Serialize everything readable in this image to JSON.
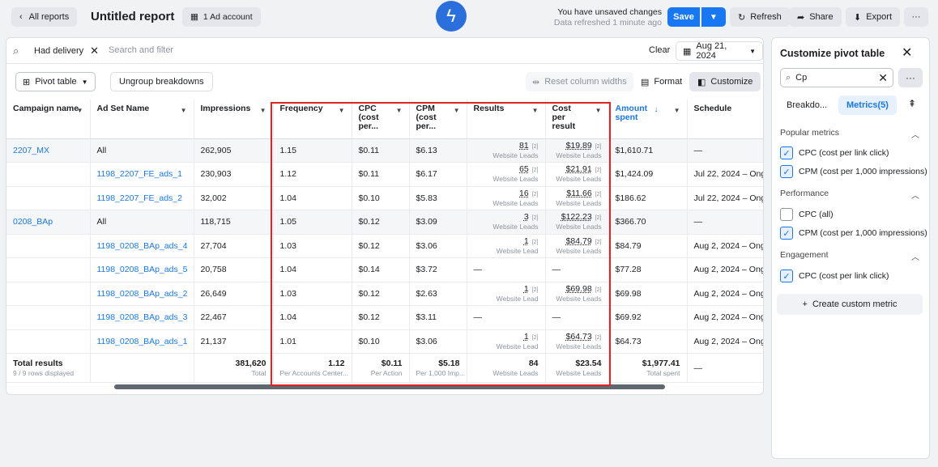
{
  "topbar": {
    "back_label": "All reports",
    "title": "Untitled report",
    "account_label": "1 Ad account",
    "unsaved_line1": "You have unsaved changes",
    "unsaved_line2": "Data refreshed 1 minute ago",
    "save_label": "Save",
    "refresh_label": "Refresh",
    "share_label": "Share",
    "export_label": "Export"
  },
  "filterbar": {
    "chip_label": "Had delivery",
    "search_placeholder": "Search and filter",
    "clear_label": "Clear",
    "date_label": "Aug 21, 2024"
  },
  "toolbar": {
    "pivot_label": "Pivot table",
    "ungroup_label": "Ungroup breakdowns",
    "reset_label": "Reset column widths",
    "format_label": "Format",
    "customize_label": "Customize"
  },
  "table": {
    "headers": [
      "Campaign name",
      "Ad Set Name",
      "Impressions",
      "Frequency",
      "CPC (cost per...",
      "CPM (cost per...",
      "Results",
      "Cost per result",
      "Amount spent",
      "Schedule"
    ],
    "rows": [
      {
        "campaign": "2207_MX",
        "adset": "All",
        "impressions": "262,905",
        "frequency": "1.15",
        "cpc": "$0.11",
        "cpm": "$6.13",
        "results": "81",
        "results_label": "Website Leads",
        "cpr": "$19.89",
        "cpr_label": "Website Leads",
        "spent": "$1,610.71",
        "schedule": "—",
        "group": true
      },
      {
        "campaign": "",
        "adset": "1198_2207_FE_ads_1",
        "impressions": "230,903",
        "frequency": "1.12",
        "cpc": "$0.11",
        "cpm": "$6.17",
        "results": "65",
        "results_label": "Website Leads",
        "cpr": "$21.91",
        "cpr_label": "Website Leads",
        "spent": "$1,424.09",
        "schedule": "Jul 22, 2024 – Ongoing",
        "group": false
      },
      {
        "campaign": "",
        "adset": "1198_2207_FE_ads_2",
        "impressions": "32,002",
        "frequency": "1.04",
        "cpc": "$0.10",
        "cpm": "$5.83",
        "results": "16",
        "results_label": "Website Leads",
        "cpr": "$11.66",
        "cpr_label": "Website Leads",
        "spent": "$186.62",
        "schedule": "Jul 22, 2024 – Ongoing",
        "group": false
      },
      {
        "campaign": "0208_BAp",
        "adset": "All",
        "impressions": "118,715",
        "frequency": "1.05",
        "cpc": "$0.12",
        "cpm": "$3.09",
        "results": "3",
        "results_label": "Website Leads",
        "cpr": "$122.23",
        "cpr_label": "Website Leads",
        "spent": "$366.70",
        "schedule": "—",
        "group": true
      },
      {
        "campaign": "",
        "adset": "1198_0208_BAp_ads_4",
        "impressions": "27,704",
        "frequency": "1.03",
        "cpc": "$0.12",
        "cpm": "$3.06",
        "results": "1",
        "results_label": "Website Lead",
        "cpr": "$84.79",
        "cpr_label": "Website Leads",
        "spent": "$84.79",
        "schedule": "Aug 2, 2024 – Ongoing",
        "group": false
      },
      {
        "campaign": "",
        "adset": "1198_0208_BAp_ads_5",
        "impressions": "20,758",
        "frequency": "1.04",
        "cpc": "$0.14",
        "cpm": "$3.72",
        "results": "—",
        "results_label": "",
        "cpr": "—",
        "cpr_label": "",
        "spent": "$77.28",
        "schedule": "Aug 2, 2024 – Ongoing",
        "group": false
      },
      {
        "campaign": "",
        "adset": "1198_0208_BAp_ads_2",
        "impressions": "26,649",
        "frequency": "1.03",
        "cpc": "$0.12",
        "cpm": "$2.63",
        "results": "1",
        "results_label": "Website Lead",
        "cpr": "$69.98",
        "cpr_label": "Website Leads",
        "spent": "$69.98",
        "schedule": "Aug 2, 2024 – Ongoing",
        "group": false
      },
      {
        "campaign": "",
        "adset": "1198_0208_BAp_ads_3",
        "impressions": "22,467",
        "frequency": "1.04",
        "cpc": "$0.12",
        "cpm": "$3.11",
        "results": "—",
        "results_label": "",
        "cpr": "—",
        "cpr_label": "",
        "spent": "$69.92",
        "schedule": "Aug 2, 2024 – Ongoing",
        "group": false
      },
      {
        "campaign": "",
        "adset": "1198_0208_BAp_ads_1",
        "impressions": "21,137",
        "frequency": "1.01",
        "cpc": "$0.10",
        "cpm": "$3.06",
        "results": "1",
        "results_label": "Website Lead",
        "cpr": "$64.73",
        "cpr_label": "Website Leads",
        "spent": "$64.73",
        "schedule": "Aug 2, 2024 – Ongoing",
        "group": false
      }
    ],
    "totals": {
      "label": "Total results",
      "sublabel": "9 / 9 rows displayed",
      "impressions": "381,620",
      "impressions_sub": "Total",
      "frequency": "1.12",
      "frequency_sub": "Per Accounts Center...",
      "cpc": "$0.11",
      "cpc_sub": "Per Action",
      "cpm": "$5.18",
      "cpm_sub": "Per 1,000 Imp...",
      "results": "84",
      "results_sub": "Website Leads",
      "cpr": "$23.54",
      "cpr_sub": "Website Leads",
      "spent": "$1,977.41",
      "spent_sub": "Total spent",
      "schedule": "—"
    }
  },
  "panel": {
    "title": "Customize pivot table",
    "search_value": "Cp",
    "tab_breakdowns": "Breakdo...",
    "tab_metrics": "Metrics(5)",
    "popular_label": "Popular metrics",
    "performance_label": "Performance",
    "engagement_label": "Engagement",
    "opt_cpc_link": "CPC (cost per link click)",
    "opt_cpm": "CPM (cost per 1,000 impressions)",
    "opt_cpc_all": "CPC (all)",
    "create_label": "Create custom metric"
  },
  "colors": {
    "accent": "#1877f2",
    "highlight": "#e02424"
  }
}
